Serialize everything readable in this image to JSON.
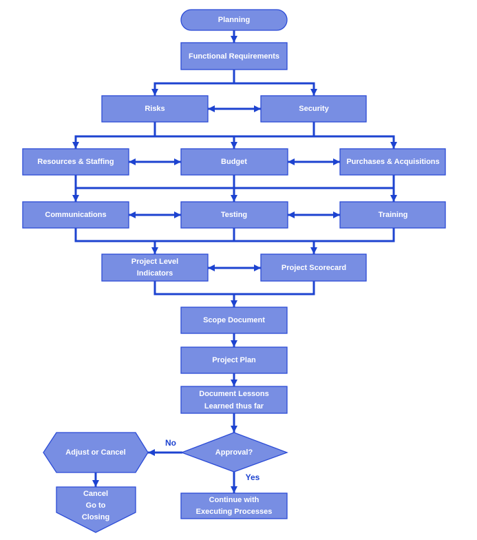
{
  "diagram": {
    "type": "flowchart",
    "nodes": {
      "planning": {
        "shape": "terminator",
        "label": "Planning"
      },
      "functional_requirements": {
        "shape": "process",
        "label": "Functional Requirements"
      },
      "risks": {
        "shape": "process",
        "label": "Risks"
      },
      "security": {
        "shape": "process",
        "label": "Security"
      },
      "resources_staffing": {
        "shape": "process",
        "label": "Resources & Staffing"
      },
      "budget": {
        "shape": "process",
        "label": "Budget"
      },
      "purchases_acquisitions": {
        "shape": "process",
        "label": "Purchases & Acquisitions"
      },
      "communications": {
        "shape": "process",
        "label": "Communications"
      },
      "testing": {
        "shape": "process",
        "label": "Testing"
      },
      "training": {
        "shape": "process",
        "label": "Training"
      },
      "project_level_indicators": {
        "shape": "process",
        "lines": [
          "Project Level",
          "Indicators"
        ]
      },
      "project_scorecard": {
        "shape": "process",
        "label": "Project Scorecard"
      },
      "scope_document": {
        "shape": "process",
        "label": "Scope Document"
      },
      "project_plan": {
        "shape": "process",
        "label": "Project Plan"
      },
      "document_lessons": {
        "shape": "process",
        "lines": [
          "Document Lessons",
          "Learned thus far"
        ]
      },
      "approval": {
        "shape": "decision",
        "label": "Approval?"
      },
      "continue_executing": {
        "shape": "process",
        "lines": [
          "Continue with",
          "Executing Processes"
        ]
      },
      "adjust_or_cancel": {
        "shape": "preparation",
        "label": "Adjust or Cancel"
      },
      "cancel_closing": {
        "shape": "off-page-connector",
        "lines": [
          "Cancel",
          "Go to",
          "Closing"
        ]
      }
    },
    "edge_labels": {
      "no": "No",
      "yes": "Yes"
    },
    "edges": [
      {
        "from": "planning",
        "to": "functional_requirements"
      },
      {
        "from": "functional_requirements",
        "to": "risks"
      },
      {
        "from": "functional_requirements",
        "to": "security"
      },
      {
        "from": "risks",
        "to": "security",
        "bidirectional": true
      },
      {
        "from": "risks",
        "to": "resources_staffing"
      },
      {
        "from": "risks",
        "to": "budget"
      },
      {
        "from": "risks",
        "to": "purchases_acquisitions"
      },
      {
        "from": "security",
        "to": "resources_staffing"
      },
      {
        "from": "security",
        "to": "budget"
      },
      {
        "from": "security",
        "to": "purchases_acquisitions"
      },
      {
        "from": "resources_staffing",
        "to": "budget",
        "bidirectional": true
      },
      {
        "from": "budget",
        "to": "purchases_acquisitions",
        "bidirectional": true
      },
      {
        "from": "resources_staffing",
        "to": "communications"
      },
      {
        "from": "budget",
        "to": "testing"
      },
      {
        "from": "purchases_acquisitions",
        "to": "training"
      },
      {
        "from": "communications",
        "to": "testing",
        "bidirectional": true
      },
      {
        "from": "testing",
        "to": "training",
        "bidirectional": true
      },
      {
        "from": "communications",
        "to": "project_level_indicators"
      },
      {
        "from": "testing",
        "to": "project_scorecard"
      },
      {
        "from": "training",
        "to": "project_scorecard"
      },
      {
        "from": "project_level_indicators",
        "to": "project_scorecard",
        "bidirectional": true
      },
      {
        "from": "project_level_indicators",
        "to": "scope_document"
      },
      {
        "from": "project_scorecard",
        "to": "scope_document"
      },
      {
        "from": "scope_document",
        "to": "project_plan"
      },
      {
        "from": "project_plan",
        "to": "document_lessons"
      },
      {
        "from": "document_lessons",
        "to": "approval"
      },
      {
        "from": "approval",
        "to": "continue_executing",
        "label": "Yes"
      },
      {
        "from": "approval",
        "to": "adjust_or_cancel",
        "label": "No"
      },
      {
        "from": "adjust_or_cancel",
        "to": "cancel_closing"
      }
    ],
    "colors": {
      "node_fill": "#788ee3",
      "node_stroke": "#2b4bd6",
      "connector": "#1d43d0",
      "node_text": "#ffffff",
      "label_text": "#1d43d0"
    }
  }
}
